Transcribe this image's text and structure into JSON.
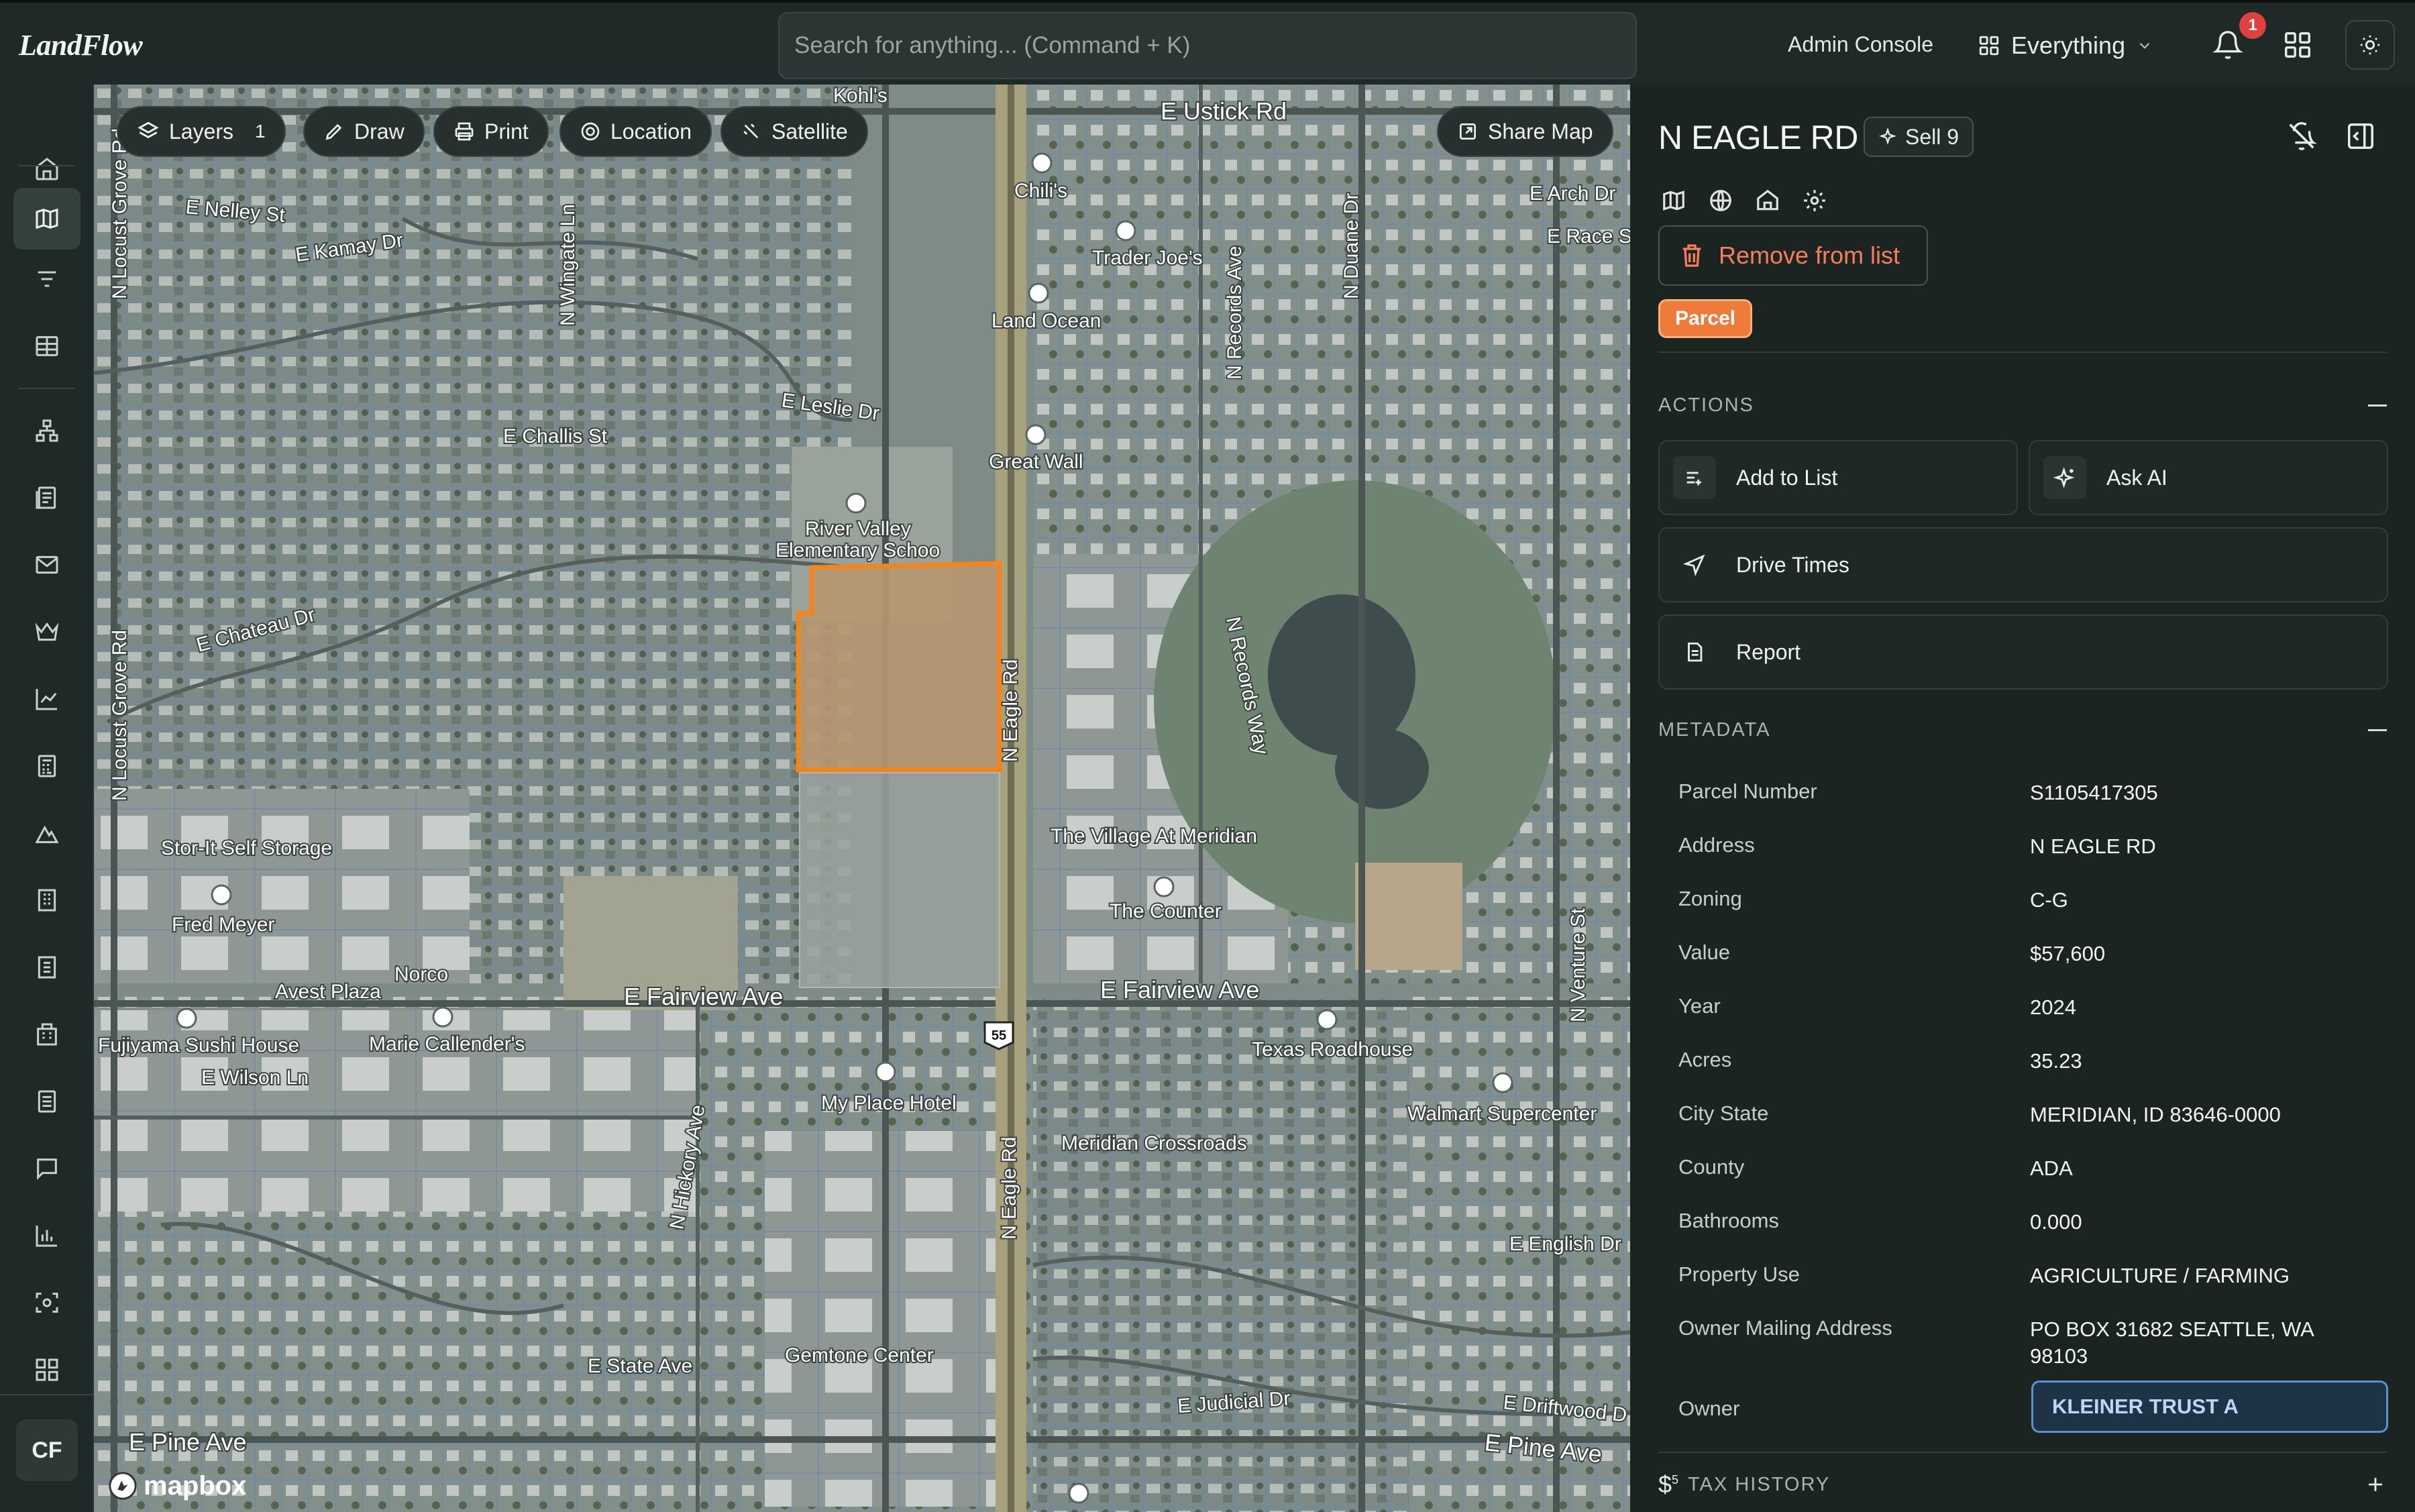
{
  "app": {
    "logo": "LandFlow"
  },
  "header": {
    "search_placeholder": "Search for anything... (Command + K)",
    "admin_label": "Admin Console",
    "scope_label": "Everything",
    "notification_count": "1"
  },
  "sidebar": {
    "items": [
      "home",
      "map",
      "filters",
      "table",
      "hierarchy",
      "documents",
      "mail",
      "crown",
      "trends",
      "calculator",
      "terrain",
      "building",
      "building-alt",
      "office",
      "records",
      "messages",
      "bar-chart",
      "scan",
      "grid"
    ],
    "active": "map",
    "avatar_initials": "CF"
  },
  "map": {
    "toolbar": {
      "layers_label": "Layers",
      "layers_count": "1",
      "draw_label": "Draw",
      "print_label": "Print",
      "location_label": "Location",
      "satellite_label": "Satellite",
      "share_label": "Share Map"
    },
    "attribution": "mapbox",
    "highway_shield": "55",
    "labels": {
      "kohls": "Kohl's",
      "ustick": "E Ustick Rd",
      "nelley": "E Nelley St",
      "kamay": "E Kamay Dr",
      "wingate": "N Wingate Ln",
      "locust_n": "N Locust Grove Rd",
      "chilis": "Chili's",
      "traderjoes": "Trader Joe's",
      "landocean": "Land Ocean",
      "records_n": "N Records Ave",
      "duane": "N Duane Dr",
      "arch": "E Arch Dr",
      "race": "E Race St",
      "leslie": "E Leslie Dr",
      "challis": "E Challis St",
      "greatwall": "Great Wall",
      "rivervalley": "River Valley",
      "elementary": "Elementary Schoo",
      "chateau": "E Chateau Dr",
      "locust_s": "N Locust Grove Rd",
      "eagle_n": "N Eagle Rd",
      "records_way": "N Records Way",
      "villagemeridian": "The Village At Meridian",
      "storit": "Stor-It Self Storage",
      "thecounter": "The Counter",
      "fredmeyer": "Fred Meyer",
      "norco": "Norco",
      "avest": "Avest Plaza",
      "fairview_w": "E Fairview Ave",
      "fairview_e": "E Fairview Ave",
      "fujiyama": "Fujiyama Sushi House",
      "mariecallenders": "Marie Callender's",
      "texasroadhouse": "Texas Roadhouse",
      "ventures": "N Venture St",
      "wilson": "E Wilson Ln",
      "myplace": "My Place Hotel",
      "walmart": "Walmart Supercenter",
      "hickory": "N Hickory Ave",
      "meridiancrossroads": "Meridian Crossroads",
      "eagle_s": "N Eagle Rd",
      "english": "E English Dr",
      "gemtone": "Gemtone Center",
      "state": "E State Ave",
      "judicial": "E Judicial Dr",
      "driftwood": "E Driftwood D",
      "pine_w": "E Pine Ave",
      "pine_e": "E Pine Ave"
    }
  },
  "panel": {
    "title": "N EAGLE RD",
    "sell_chip": "Sell 9",
    "remove_label": "Remove from list",
    "type_badge": "Parcel",
    "actions_heading": "ACTIONS",
    "actions": {
      "add_to_list": "Add to List",
      "ask_ai": "Ask AI",
      "drive_times": "Drive Times",
      "report": "Report"
    },
    "metadata_heading": "METADATA",
    "metadata": [
      {
        "key": "Parcel Number",
        "value": "S1105417305"
      },
      {
        "key": "Address",
        "value": "N EAGLE RD"
      },
      {
        "key": "Zoning",
        "value": "C-G"
      },
      {
        "key": "Value",
        "value": "$57,600"
      },
      {
        "key": "Year",
        "value": "2024"
      },
      {
        "key": "Acres",
        "value": "35.23"
      },
      {
        "key": "City State",
        "value": "MERIDIAN, ID 83646-0000"
      },
      {
        "key": "County",
        "value": "ADA"
      },
      {
        "key": "Bathrooms",
        "value": "0.000"
      },
      {
        "key": "Property Use",
        "value": "AGRICULTURE / FARMING"
      },
      {
        "key": "Owner Mailing Address",
        "value": "PO BOX 31682 SEATTLE, WA 98103"
      }
    ],
    "owner_label": "Owner",
    "owner_value": "KLEINER TRUST A",
    "tax_heading": "TAX HISTORY",
    "tax_icon_superscript": "5"
  },
  "colors": {
    "accent_orange": "#ee7b3a",
    "danger": "#f47e5e",
    "owner_blue": "#5d8fd6",
    "notification_red": "#e0403f"
  }
}
